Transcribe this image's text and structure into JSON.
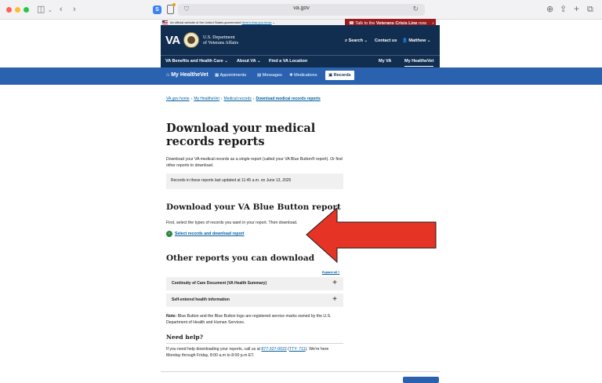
{
  "browser": {
    "url": "va.gov"
  },
  "banner": {
    "official_text": "An official website of the United States government",
    "know_link": "Here's how you know",
    "crisis_prefix": "Talk to the",
    "crisis_bold": "Veterans Crisis Line",
    "crisis_suffix": "now"
  },
  "header": {
    "logo": "VA",
    "dept_line1": "U.S. Department",
    "dept_line2": "of Veterans Affairs",
    "search": "Search",
    "contact": "Contact us",
    "user": "Matthew"
  },
  "nav": {
    "items": [
      "VA Benefits and Health Care",
      "About VA",
      "Find a VA Location",
      "My VA",
      "My HealtheVet"
    ]
  },
  "mhv": {
    "brand": "My HealtheVet",
    "items": [
      "Appointments",
      "Messages",
      "Medications",
      "Records"
    ]
  },
  "breadcrumb": {
    "items": [
      "VA.gov home",
      "My HealtheVet",
      "Medical records"
    ],
    "current": "Download medical records reports"
  },
  "main": {
    "title": "Download your medical records reports",
    "intro": "Download your VA medical records as a single report (called your VA Blue Button® report). Or find other reports to download.",
    "last_updated": "Records in these reports last updated at 11:45 a.m. on June 13, 2025",
    "bb_heading": "Download your VA Blue Button report",
    "bb_text": "First, select the types of records you want in your report. Then download.",
    "bb_link": "Select records and download report",
    "other_heading": "Other reports you can download",
    "expand_all": "Expand all +",
    "accordions": [
      "Continuity of Care Document (VA Health Summary)",
      "Self-entered health information"
    ],
    "note_label": "Note:",
    "note_text": "Blue Button and the Blue Button logo are registered service marks owned by the U.S. Department of Health and Human Services.",
    "help_heading": "Need help?",
    "help_text_1": "If you need help downloading your reports, call us at",
    "help_phone": "877-327-0022",
    "help_tty": "TTY: 711",
    "help_text_2": "). We're here Monday through Friday, 8:00 a.m to 8:00 p.m ET."
  },
  "colors": {
    "header": "#112e51",
    "mhv_bar": "#2a62b0",
    "link": "#005ea2",
    "arrow": "#e53426",
    "crisis": "#981b1e"
  }
}
